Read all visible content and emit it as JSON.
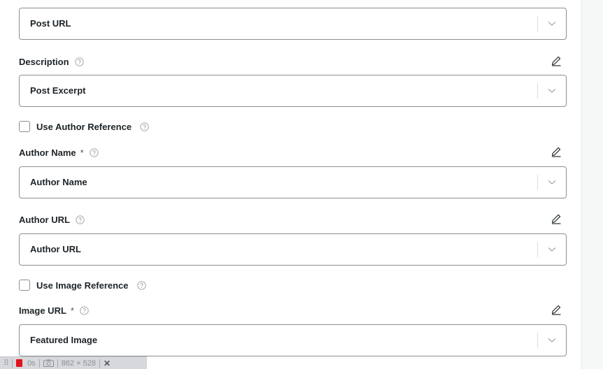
{
  "fields": {
    "post_url_select": "Post URL",
    "description_label": "Description",
    "description_select": "Post Excerpt",
    "use_author_reference": "Use Author Reference",
    "author_name_label": "Author Name",
    "required_mark": "*",
    "author_name_select": "Author Name",
    "author_url_label": "Author URL",
    "author_url_select": "Author URL",
    "use_image_reference": "Use Image Reference",
    "image_url_label": "Image URL",
    "image_url_select": "Featured Image"
  },
  "devbar": {
    "timer": "0s",
    "dimensions": "862 × 528"
  }
}
